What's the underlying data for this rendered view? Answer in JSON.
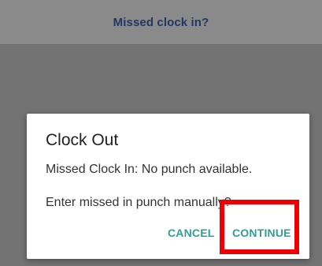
{
  "header": {
    "title": "Missed clock in?"
  },
  "dialog": {
    "title": "Clock Out",
    "message": "Missed Clock In: No punch available.",
    "question": "Enter missed in punch manually?",
    "cancel_label": "CANCEL",
    "continue_label": "CONTINUE"
  },
  "colors": {
    "accent": "#2f9e97",
    "header_text": "#1f3866",
    "highlight": "#ee0000"
  }
}
